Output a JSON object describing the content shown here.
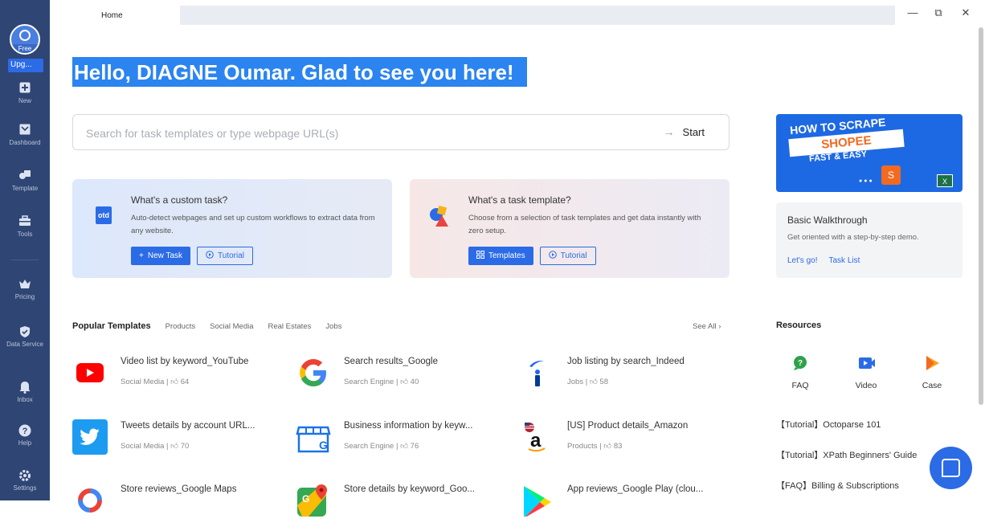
{
  "sidebar": {
    "avatar_badge": "Free",
    "upgrade": "Upg...",
    "items": [
      {
        "label": "New",
        "icon": "plus-square-icon"
      },
      {
        "label": "Dashboard",
        "icon": "dashboard-icon"
      },
      {
        "label": "Template",
        "icon": "template-icon"
      },
      {
        "label": "Tools",
        "icon": "toolbox-icon"
      },
      {
        "label": "Pricing",
        "icon": "crown-icon"
      },
      {
        "label": "Data Service",
        "icon": "shield-check-icon"
      },
      {
        "label": "Inbox",
        "icon": "bell-icon"
      },
      {
        "label": "Help",
        "icon": "question-circle-icon"
      },
      {
        "label": "Settings",
        "icon": "gear-icon"
      }
    ]
  },
  "tabs": {
    "home": "Home"
  },
  "window": {
    "minimize": "—",
    "restore": "⧉",
    "close": "✕"
  },
  "greeting": "Hello, DIAGNE Oumar. Glad to see you here!",
  "search": {
    "placeholder": "Search for task templates or type webpage URL(s)",
    "start_label": "Start"
  },
  "cards": {
    "custom": {
      "title": "What's a custom task?",
      "desc": "Auto-detect webpages and set up custom workflows to extract data from any website.",
      "primary": "New Task",
      "secondary": "Tutorial",
      "icon_text": "otd"
    },
    "template": {
      "title": "What's a task template?",
      "desc": "Choose from a selection of task templates and get data instantly with zero setup.",
      "primary": "Templates",
      "secondary": "Tutorial"
    }
  },
  "promo": {
    "line1": "HOW TO SCRAPE",
    "line2": "SHOPEE",
    "line3": "FAST & EASY"
  },
  "walkthrough": {
    "title": "Basic Walkthrough",
    "desc": "Get oriented with a step-by-step demo.",
    "link1": "Let's go!",
    "link2": "Task List"
  },
  "popular": {
    "title": "Popular Templates",
    "tabs": [
      "Products",
      "Social Media",
      "Real Estates",
      "Jobs"
    ],
    "see_all": "See All",
    "items": [
      {
        "name": "Video list by keyword_YouTube",
        "category": "Social Media",
        "likes": "64"
      },
      {
        "name": "Search results_Google",
        "category": "Search Engine",
        "likes": "40"
      },
      {
        "name": "Job listing by search_Indeed",
        "category": "Jobs",
        "likes": "58"
      },
      {
        "name": "Tweets details by account URL...",
        "category": "Social Media",
        "likes": "70"
      },
      {
        "name": "Business information by keyw...",
        "category": "Search Engine",
        "likes": "76"
      },
      {
        "name": "[US] Product details_Amazon",
        "category": "Products",
        "likes": "83"
      },
      {
        "name": "Store reviews_Google Maps",
        "category": "",
        "likes": ""
      },
      {
        "name": "Store details by keyword_Goo...",
        "category": "",
        "likes": ""
      },
      {
        "name": "App reviews_Google Play (clou...",
        "category": "",
        "likes": ""
      }
    ]
  },
  "resources": {
    "title": "Resources",
    "icons": [
      {
        "label": "FAQ"
      },
      {
        "label": "Video"
      },
      {
        "label": "Case"
      }
    ],
    "links": [
      "【Tutorial】Octoparse 101",
      "【Tutorial】XPath Beginners' Guide",
      "【FAQ】Billing & Subscriptions"
    ]
  },
  "colors": {
    "sidebar": "#2f4574",
    "accent": "#2b6be6",
    "greeting_bg": "#2b84f0"
  }
}
